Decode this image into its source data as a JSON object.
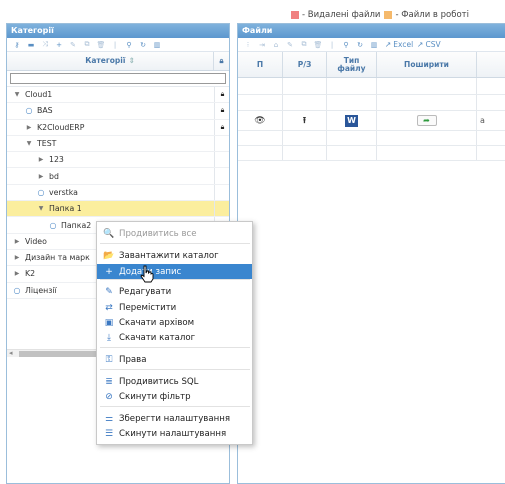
{
  "legend": {
    "deleted": {
      "label": "- Видалені файли",
      "color": "#f08080"
    },
    "in_work": {
      "label": "- Файли в роботі",
      "color": "#f5b96b"
    }
  },
  "left_panel": {
    "title": "Категорії",
    "column_header": "Категорії",
    "search_value": "",
    "tree": [
      {
        "label": "Cloud1",
        "level": 0,
        "toggle": "expanded",
        "locked": true
      },
      {
        "label": "BAS",
        "level": 1,
        "toggle": "leaf",
        "locked": true
      },
      {
        "label": "K2CloudERP",
        "level": 1,
        "toggle": "collapsed",
        "locked": true
      },
      {
        "label": "TEST",
        "level": 1,
        "toggle": "expanded",
        "locked": false
      },
      {
        "label": "123",
        "level": 2,
        "toggle": "collapsed",
        "locked": false
      },
      {
        "label": "bd",
        "level": 2,
        "toggle": "collapsed",
        "locked": false
      },
      {
        "label": "verstka",
        "level": 2,
        "toggle": "leaf",
        "locked": false
      },
      {
        "label": "Папка 1",
        "level": 2,
        "toggle": "expanded",
        "locked": false,
        "selected": true
      },
      {
        "label": "Папка2",
        "level": 3,
        "toggle": "leaf",
        "locked": false
      },
      {
        "label": "Video",
        "level": 0,
        "toggle": "collapsed",
        "locked": false
      },
      {
        "label": "Дизайн та марк",
        "level": 0,
        "toggle": "collapsed",
        "locked": false
      },
      {
        "label": "K2",
        "level": 0,
        "toggle": "collapsed",
        "locked": false
      },
      {
        "label": "Ліцензії",
        "level": 0,
        "toggle": "leaf",
        "locked": false
      }
    ]
  },
  "right_panel": {
    "title": "Файли",
    "toolbar": {
      "excel_label": "Excel",
      "csv_label": "CSV"
    },
    "columns": [
      "П",
      "Р/З",
      "Тип файлу",
      "Поширити"
    ],
    "file_type_icon_letter": "W"
  },
  "context_menu": {
    "items": [
      {
        "icon": "search-icon",
        "glyph": "🔍",
        "label": "Продивитись все",
        "disabled": true
      },
      {
        "icon": "folder-open-icon",
        "glyph": "📂",
        "label": "Завантажити каталог"
      },
      {
        "icon": "plus-icon",
        "glyph": "+",
        "label": "Додати запис",
        "active": true
      },
      {
        "icon": "edit-icon",
        "glyph": "✎",
        "label": "Редагувати"
      },
      {
        "icon": "move-icon",
        "glyph": "⇄",
        "label": "Перемістити"
      },
      {
        "icon": "archive-icon",
        "glyph": "▣",
        "label": "Скачати архівом"
      },
      {
        "icon": "download-icon",
        "glyph": "⤓",
        "label": "Скачати каталог"
      },
      {
        "icon": "permissions-icon",
        "glyph": "⚿",
        "label": "Права"
      },
      {
        "icon": "database-icon",
        "glyph": "≣",
        "label": "Продивитись SQL"
      },
      {
        "icon": "reset-filter-icon",
        "glyph": "⊘",
        "label": "Скинути фільтр"
      },
      {
        "icon": "settings-save-icon",
        "glyph": "⚌",
        "label": "Зберегти налаштування"
      },
      {
        "icon": "settings-reset-icon",
        "glyph": "☰",
        "label": "Скинути налаштування"
      }
    ]
  }
}
